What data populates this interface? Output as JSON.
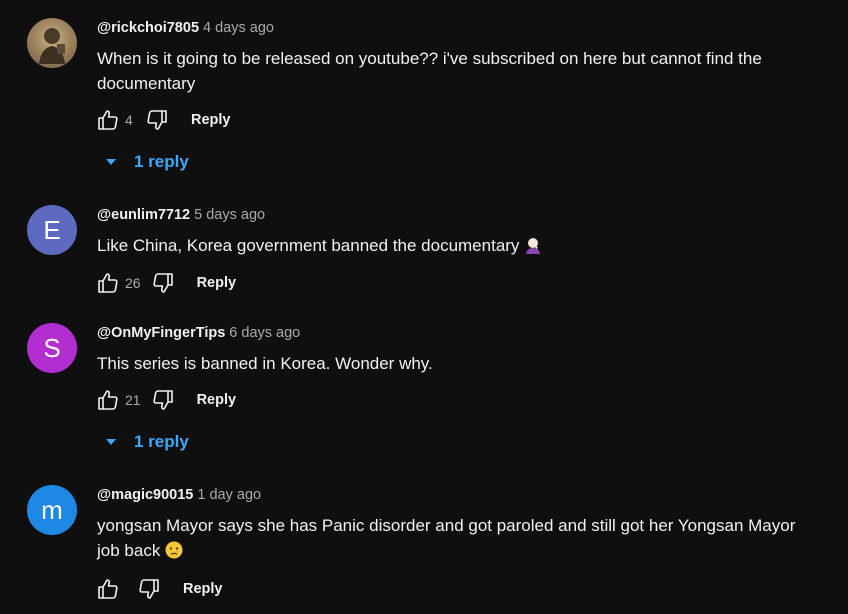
{
  "comments": [
    {
      "author": "@rickchoi7805",
      "time": "4 days ago",
      "text": "When is it going to be released on youtube?? i've subscribed on here but cannot find the documentary",
      "likes": "4",
      "reply_label": "Reply",
      "replies_label": "1 reply",
      "avatar_letter": ""
    },
    {
      "author": "@eunlim7712",
      "time": "5 days ago",
      "text": "Like China, Korea government banned the documentary",
      "emoji": "facepalm",
      "likes": "26",
      "reply_label": "Reply",
      "avatar_letter": "E",
      "avatar_color": "#5c6bc0"
    },
    {
      "author": "@OnMyFingerTips",
      "time": "6 days ago",
      "text": "This series is banned in Korea. Wonder why.",
      "likes": "21",
      "reply_label": "Reply",
      "replies_label": "1 reply",
      "avatar_letter": "S",
      "avatar_color": "#b22ed0"
    },
    {
      "author": "@magic90015",
      "time": "1 day ago",
      "text": "yongsan Mayor says she has Panic disorder and got paroled and still got her Yongsan Mayor job back",
      "emoji": "crying-face",
      "likes": "",
      "reply_label": "Reply",
      "avatar_letter": "m",
      "avatar_color": "#1e88e5"
    }
  ],
  "colors": {
    "background": "#0f0f0f",
    "link_blue": "#3ea6ff",
    "secondary_text": "#aaaaaa"
  }
}
